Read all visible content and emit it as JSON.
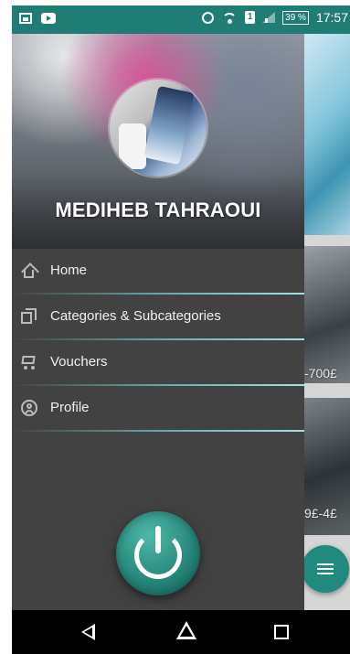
{
  "status_bar": {
    "battery": "39 %",
    "time": "17:57",
    "sim": "1",
    "icons": [
      "image-icon",
      "youtube-icon",
      "alarm-icon",
      "wifi-icon",
      "sim-icon",
      "signal-icon",
      "battery-icon"
    ]
  },
  "drawer": {
    "user_name": "MEDIHEB TAHRAOUI",
    "items": [
      {
        "label": "Home",
        "icon": "home-icon"
      },
      {
        "label": "Categories & Subcategories",
        "icon": "categories-icon"
      },
      {
        "label": "Vouchers",
        "icon": "cart-icon"
      },
      {
        "label": "Profile",
        "icon": "profile-icon"
      }
    ],
    "logout_icon": "power-icon"
  },
  "background": {
    "price_1": "-700£",
    "price_2": "9£-4£"
  },
  "colors": {
    "accent": "#1f7d75",
    "drawer_bg": "#424242",
    "menu_text": "#f0f0f0"
  },
  "nav_bar": {
    "icons": [
      "back-icon",
      "home-nav-icon",
      "recent-apps-icon"
    ]
  }
}
